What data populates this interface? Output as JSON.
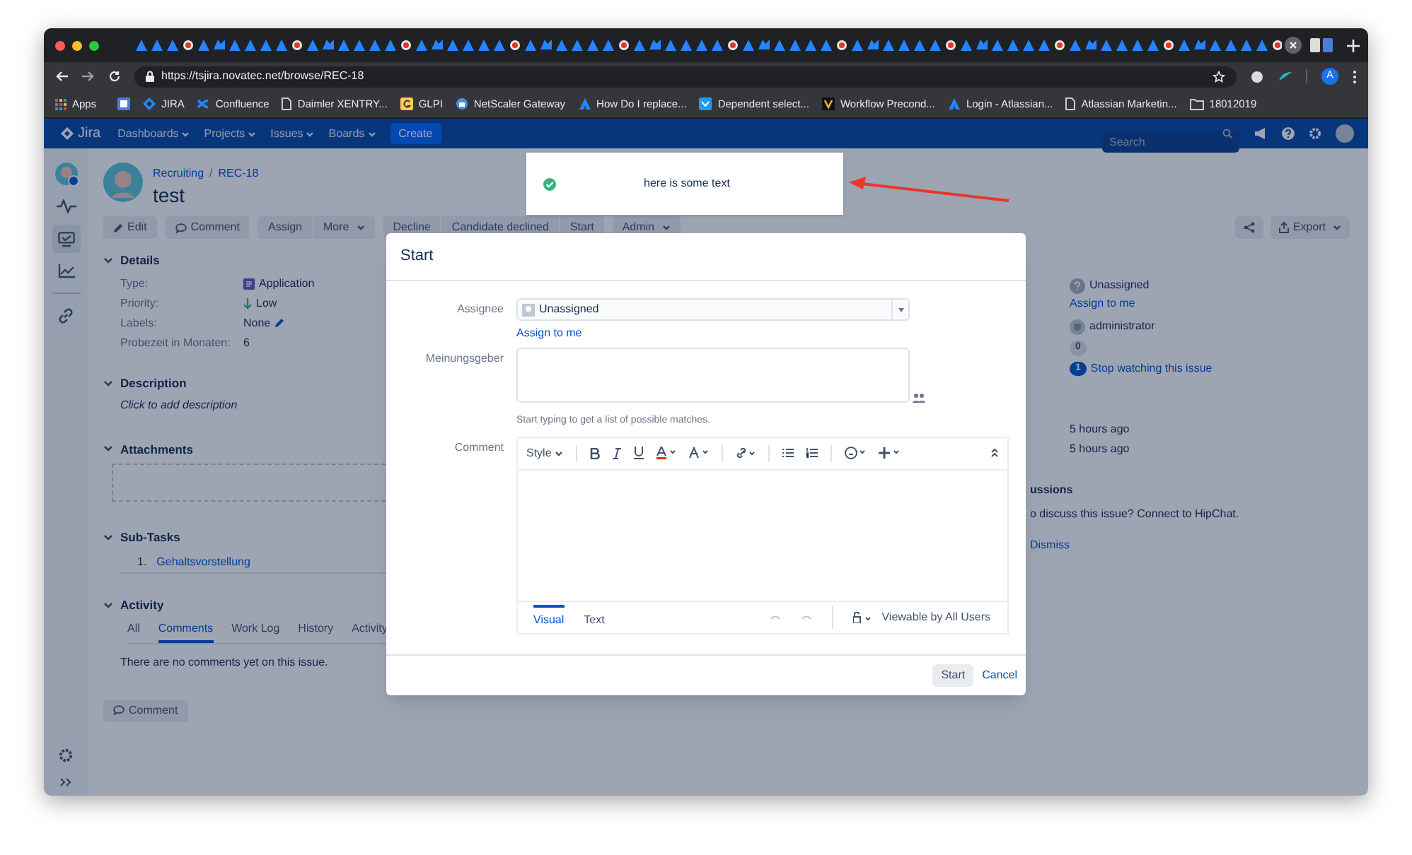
{
  "browser": {
    "url": "https://tsjira.novatec.net/browse/REC-18",
    "profile_initial": "A",
    "bookmarks": [
      {
        "label": "Apps",
        "kind": "apps"
      },
      {
        "label": "JIRA",
        "kind": "jira"
      },
      {
        "label": "Confluence",
        "kind": "confluence"
      },
      {
        "label": "Daimler XENTRY...",
        "kind": "doc"
      },
      {
        "label": "GLPI",
        "kind": "glpi"
      },
      {
        "label": "NetScaler Gateway",
        "kind": "netscaler"
      },
      {
        "label": "How Do I replace...",
        "kind": "atlassian"
      },
      {
        "label": "Dependent select...",
        "kind": "plugin"
      },
      {
        "label": "Workflow Precond...",
        "kind": "workflow"
      },
      {
        "label": "Login - Atlassian...",
        "kind": "atlassian"
      },
      {
        "label": "Atlassian Marketin...",
        "kind": "doc"
      },
      {
        "label": "18012019",
        "kind": "folder"
      }
    ]
  },
  "header": {
    "logo": "Jira",
    "nav": [
      "Dashboards",
      "Projects",
      "Issues",
      "Boards"
    ],
    "create": "Create",
    "search_placeholder": "Search"
  },
  "sidebar": {
    "items": [
      {
        "kind": "avatar",
        "selected": false
      },
      {
        "kind": "pulse",
        "selected": false
      },
      {
        "kind": "board",
        "selected": true
      },
      {
        "kind": "chart",
        "selected": false
      },
      {
        "kind": "link",
        "selected": false
      }
    ]
  },
  "issue": {
    "breadcrumbs": [
      "Recruiting",
      "REC-18"
    ],
    "breadcrumb_separator": "/",
    "title": "test",
    "action_groups": [
      [
        {
          "label": "Edit",
          "kind": "edit"
        }
      ],
      [
        {
          "label": "Comment",
          "kind": "comment"
        }
      ],
      [
        {
          "label": "Assign",
          "kind": "plain"
        },
        {
          "label": "More",
          "kind": "dropdown"
        }
      ],
      [
        {
          "label": "Decline",
          "kind": "plain"
        },
        {
          "label": "Candidate declined",
          "kind": "plain"
        },
        {
          "label": "Start",
          "kind": "plain"
        }
      ],
      [
        {
          "label": "Admin",
          "kind": "dropdown"
        }
      ]
    ],
    "sections": {
      "details": {
        "title": "Details",
        "expanded": true,
        "fields": [
          {
            "label": "Type:",
            "value": "Application",
            "kind": "issuetype"
          },
          {
            "label": "Priority:",
            "value": "Low",
            "kind": "priority"
          },
          {
            "label": "Labels:",
            "value": "None",
            "kind": "labels"
          },
          {
            "label": "Probezeit in Monaten:",
            "value": "6",
            "kind": "text"
          }
        ]
      },
      "description": {
        "title": "Description",
        "expanded": true,
        "placeholder": "Click to add description"
      },
      "attachments": {
        "title": "Attachments",
        "expanded": true
      },
      "subtasks": {
        "title": "Sub-Tasks",
        "expanded": true,
        "items": [
          {
            "number": "1.",
            "title": "Gehaltsvorstellung"
          }
        ]
      },
      "activity": {
        "title": "Activity",
        "expanded": true,
        "tabs": [
          {
            "label": "All",
            "selected": false
          },
          {
            "label": "Comments",
            "selected": true
          },
          {
            "label": "Work Log",
            "selected": false
          },
          {
            "label": "History",
            "selected": false
          },
          {
            "label": "Activity",
            "selected": false
          }
        ],
        "empty_text": "There are no comments yet on this issue."
      }
    },
    "comment_button": "Comment",
    "export": "Export",
    "people": {
      "assignee": "Unassigned",
      "assign_link": "Assign to me",
      "reporter": "administrator",
      "votes": "0",
      "watchers": "1",
      "watch_link": "Stop watching this issue"
    },
    "dates": [
      "5 hours ago",
      "5 hours ago"
    ],
    "hipchat": {
      "title": "ussions",
      "text": "o discuss this issue? Connect to HipChat.",
      "dismiss": "Dismiss"
    }
  },
  "flag": {
    "text": "here is some text"
  },
  "dialog": {
    "title": "Start",
    "assignee_label": "Assignee",
    "assignee_value": "Unassigned",
    "assign_link": "Assign to me",
    "opinion_label": "Meinungsgeber",
    "opinion_hint": "Start typing to get a list of possible matches.",
    "comment_label": "Comment",
    "style_menu": "Style",
    "editor_tabs": [
      {
        "label": "Visual",
        "selected": true
      },
      {
        "label": "Text",
        "selected": false
      }
    ],
    "visibility": "Viewable by All Users",
    "submit": "Start",
    "cancel": "Cancel"
  }
}
